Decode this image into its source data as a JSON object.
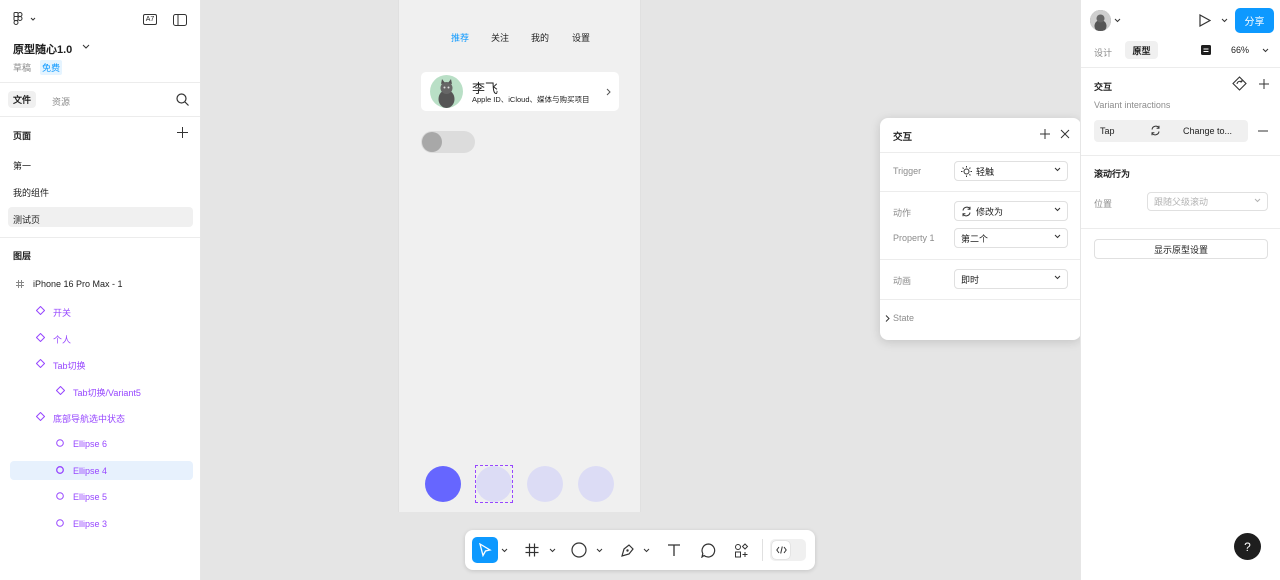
{
  "left_panel": {
    "file_name": "原型随心1.0",
    "draft_label": "草稿",
    "plan_badge": "免费",
    "tabs": [
      "文件",
      "资源"
    ],
    "pages_heading": "页面",
    "pages": [
      "第一",
      "我的组件",
      "测试页"
    ],
    "layers_heading": "图层",
    "frame_name": "iPhone 16 Pro Max - 1",
    "layers": [
      "开关",
      "个人",
      "Tab切换",
      "Tab切换/Variant5",
      "底部导航选中状态",
      "Ellipse 6",
      "Ellipse 4",
      "Ellipse 5",
      "Ellipse 3"
    ],
    "aa_badge": "A7"
  },
  "frame": {
    "tabs": [
      "推荐",
      "关注",
      "我的",
      "设置"
    ],
    "profile_name": "李飞",
    "profile_sub": "Apple ID、iCloud、媒体与购买项目"
  },
  "popup": {
    "title": "交互",
    "trigger_label": "Trigger",
    "trigger_value": "轻触",
    "action_label": "动作",
    "action_value": "修改为",
    "property_label": "Property 1",
    "property_value": "第二个",
    "animation_label": "动画",
    "animation_value": "即时",
    "state_label": "State"
  },
  "right_panel": {
    "share_label": "分享",
    "tabs": [
      "设计",
      "原型"
    ],
    "zoom": "66%",
    "interaction_heading": "交互",
    "interaction_sub": "Variant interactions",
    "tap_label": "Tap",
    "change_label": "Change to...",
    "scroll_heading": "滚动行为",
    "position_label": "位置",
    "position_placeholder": "跟随父级滚动",
    "proto_settings_label": "显示原型设置"
  },
  "colors": {
    "accent": "#0d99ff",
    "purple": "#9747ff",
    "ellipse_active": "#6666ff",
    "ellipse_idle": "#dcdcf5"
  }
}
